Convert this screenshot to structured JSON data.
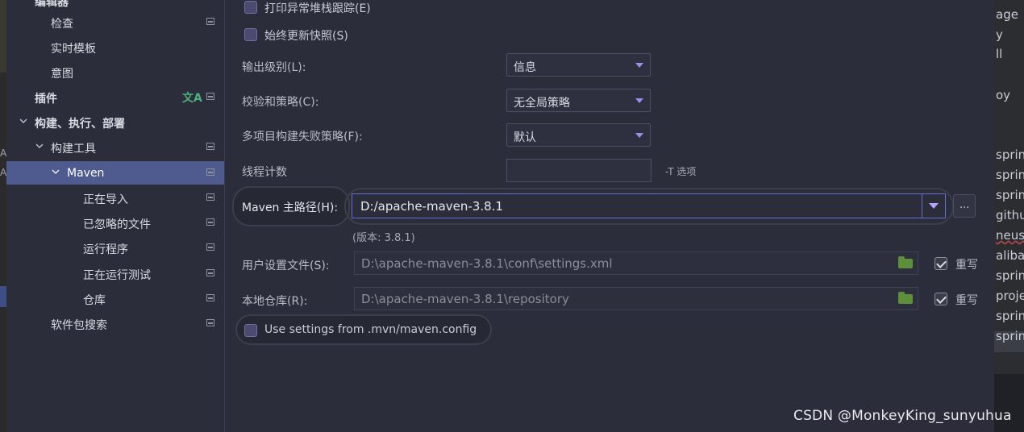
{
  "sidebar": {
    "items": [
      {
        "label": "编辑器",
        "level": 1,
        "bold": true
      },
      {
        "label": "检查",
        "level": 2
      },
      {
        "label": "实时模板",
        "level": 2
      },
      {
        "label": "意图",
        "level": 2
      },
      {
        "label": "插件",
        "level": 1,
        "bold": true
      },
      {
        "label": "构建、执行、部署",
        "level": 1,
        "bold": true,
        "expanded": true
      },
      {
        "label": "构建工具",
        "level": 2,
        "expanded": true
      },
      {
        "label": "Maven",
        "level": 3,
        "expanded": true,
        "selected": true
      },
      {
        "label": "正在导入",
        "level": 4
      },
      {
        "label": "已忽略的文件",
        "level": 4
      },
      {
        "label": "运行程序",
        "level": 4
      },
      {
        "label": "正在运行测试",
        "level": 4
      },
      {
        "label": "仓库",
        "level": 4
      },
      {
        "label": "软件包搜索",
        "level": 2
      }
    ]
  },
  "main": {
    "print_stack_traces_label": "打印异常堆栈跟踪(E)",
    "always_update_snapshots_label": "始终更新快照(S)",
    "output_level_label": "输出级别(L):",
    "output_level_value": "信息",
    "checksum_policy_label": "校验和策略(C):",
    "checksum_policy_value": "无全局策略",
    "failure_policy_label": "多项目构建失败策略(F):",
    "failure_policy_value": "默认",
    "thread_count_label": "线程计数",
    "thread_count_value": "",
    "thread_count_hint": "-T 选项",
    "maven_home_label": "Maven 主路径(H):",
    "maven_home_value": "D:/apache-maven-3.8.1",
    "browse_label": "...",
    "version_text": "(版本: 3.8.1)",
    "user_settings_label": "用户设置文件(S):",
    "user_settings_value": "D:\\apache-maven-3.8.1\\conf\\settings.xml",
    "local_repo_label": "本地仓库(R):",
    "local_repo_value": "D:\\apache-maven-3.8.1\\repository",
    "override_label": "重写",
    "mvn_config_label": "Use settings from .mvn/maven.config"
  },
  "background_right": [
    "age",
    "y",
    "ll",
    "oy",
    "sprin",
    "sprin",
    "sprin",
    "githu",
    "neus",
    "aliba",
    "sprin",
    "proje",
    "sprin",
    "sprin"
  ],
  "background_left": [
    "Al",
    "Al"
  ],
  "watermark": "CSDN @MonkeyKing_sunyuhua",
  "colors": {
    "selection": "#4f5a8f",
    "accent_caret": "#9b8fe8",
    "panel_bg": "#2b2d3a"
  }
}
